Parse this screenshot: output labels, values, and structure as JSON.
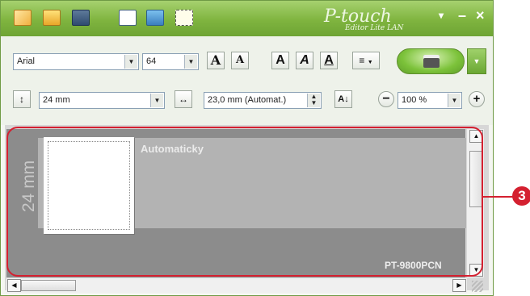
{
  "app": {
    "logo_text": "P-touch",
    "logo_subtitle": "Editor Lite LAN"
  },
  "titlebar": {
    "icons": [
      "new-label-icon",
      "open-folder-icon",
      "save-icon",
      "text-icon",
      "frame-image-icon",
      "frame-icon"
    ],
    "controls": [
      "▾",
      "–",
      "×"
    ]
  },
  "toolbar": {
    "font": {
      "value": "Arial"
    },
    "font_size": {
      "value": "64"
    },
    "style_buttons": [
      "A",
      "A",
      "A",
      "A",
      "A"
    ],
    "tape": {
      "value": "24 mm"
    },
    "length": {
      "value": "23,0 mm (Automat.)"
    },
    "zoom": {
      "value": "100 %"
    }
  },
  "canvas": {
    "tape_width_label": "24 mm",
    "auto_label": "Automaticky",
    "printer_model": "PT-9800PCN"
  },
  "callout": {
    "number": "3"
  },
  "colors": {
    "accent": "#7cc23a",
    "callout": "#d42030"
  }
}
